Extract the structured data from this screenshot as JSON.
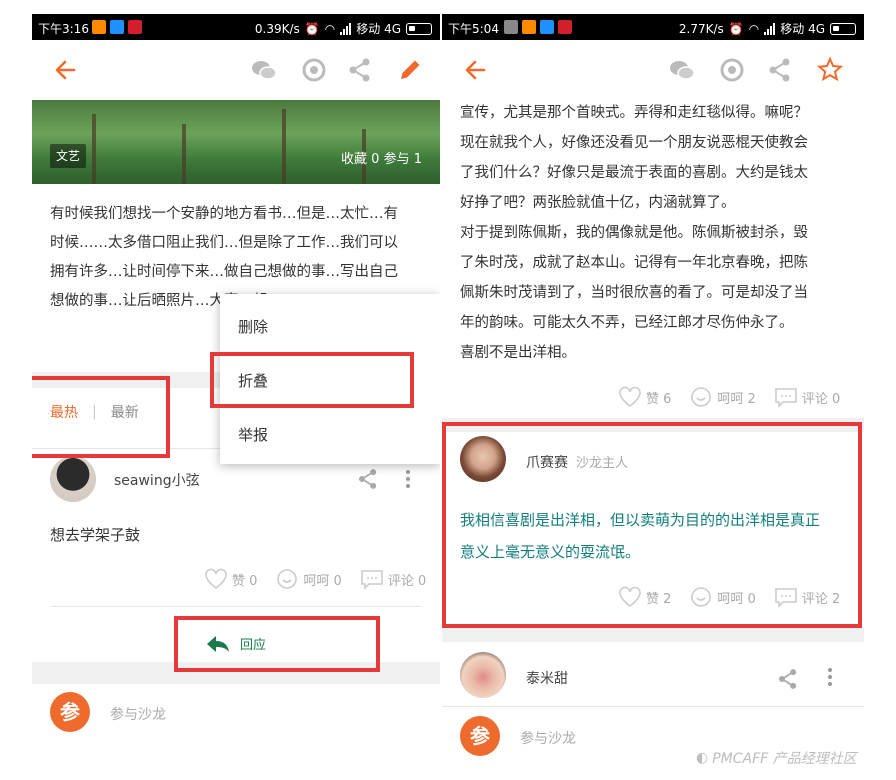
{
  "left": {
    "status": {
      "time": "下午3:16",
      "speed": "0.39K/s",
      "carrier": "移动 4G"
    },
    "cover": {
      "tag": "文艺",
      "stats": "收藏 0  参与 1"
    },
    "excerpt": [
      "有时候我们想找一个安静的地方看书…但是…太忙…有",
      "时候……太多借口阻止我们…但是除了工作…我们可以",
      "拥有许多…让时间停下来…做自己想做的事…写出自己",
      "想做的事…让后晒照片…大家一起"
    ],
    "sort": {
      "hot": "最热",
      "sep": "|",
      "new": "最新"
    },
    "menu": {
      "delete": "删除",
      "fold": "折叠",
      "report": "举报"
    },
    "comment": {
      "user": "seawing小弦",
      "text": "想去学架子鼓",
      "like": "赞 0",
      "haha": "呵呵 0",
      "comments": "评论 0"
    },
    "reply": "回应",
    "join": {
      "badge": "参",
      "label": "参与沙龙"
    }
  },
  "right": {
    "status": {
      "time": "下午5:04",
      "speed": "2.77K/s",
      "carrier": "移动 4G"
    },
    "article": [
      "宣传，尤其是那个首映式。弄得和走红毯似得。嘛呢？",
      "现在就我个人，好像还没看见一个朋友说恶棍天使教会",
      "了我们什么？好像只是最流于表面的喜剧。大约是钱太",
      "好挣了吧？两张脸就值十亿，内涵就算了。",
      "对于提到陈佩斯，我的偶像就是他。陈佩斯被封杀，毁",
      "了朱时茂，成就了赵本山。记得有一年北京春晚，把陈",
      "佩斯朱时茂请到了，当时很欣喜的看了。可是却没了当",
      "年的韵味。可能太久不弄，已经江郎才尽伤仲永了。",
      "喜剧不是出洋相。"
    ],
    "post_actions": {
      "like": "赞 6",
      "haha": "呵呵 2",
      "comments": "评论 0"
    },
    "comment": {
      "user": "爪赛赛",
      "role": "沙龙主人",
      "text": [
        "我相信喜剧是出洋相，但以卖萌为目的的出洋相是真正",
        "意义上毫无意义的耍流氓。"
      ],
      "like": "赞 2",
      "haha": "呵呵 0",
      "comments": "评论 2"
    },
    "next_user": "泰米甜",
    "join": {
      "badge": "参",
      "label": "参与沙龙"
    }
  },
  "watermark": "PMCAFF 产品经理社区",
  "colors": {
    "accent": "#ee6a2d",
    "highlight": "#e63a3a",
    "teal": "#137d7d",
    "reply_green": "#1b7a4a"
  }
}
